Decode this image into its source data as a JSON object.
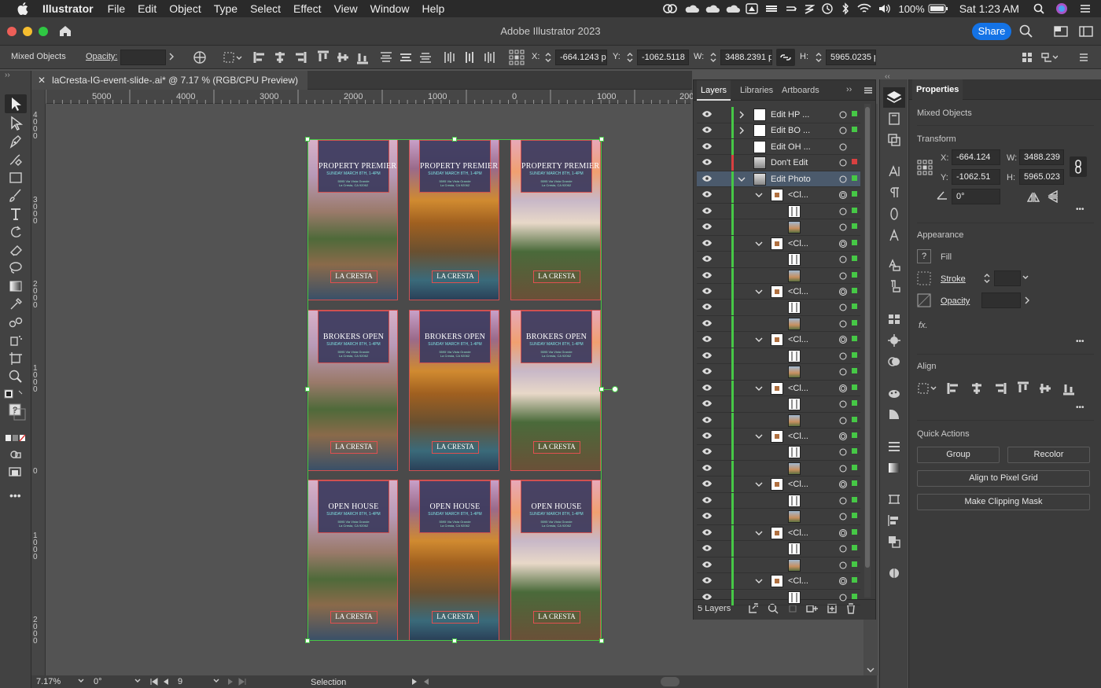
{
  "menubar": {
    "app": "Illustrator",
    "items": [
      "File",
      "Edit",
      "Object",
      "Type",
      "Select",
      "Effect",
      "View",
      "Window",
      "Help"
    ],
    "battery": "100%",
    "clock": "Sat 1:23 AM"
  },
  "window": {
    "title": "Adobe Illustrator 2023",
    "share_label": "Share"
  },
  "options_bar": {
    "selection_label": "Mixed Objects",
    "opacity_label": "Opacity:",
    "x_label": "X:",
    "x_value": "-664.1243 p",
    "y_label": "Y:",
    "y_value": "-1062.5118",
    "w_label": "W:",
    "w_value": "3488.2391 p",
    "h_label": "H:",
    "h_value": "5965.0235 p"
  },
  "document_tab": {
    "title": "laCresta-IG-event-slide-.ai* @ 7.17 % (RGB/CPU Preview)"
  },
  "ruler": {
    "h_ticks": [
      "5000",
      "4000",
      "3000",
      "2000",
      "1000",
      "0",
      "1000",
      "200"
    ],
    "v_ticks": [
      "4\n0\n0\n0",
      "3\n0\n0\n0",
      "2\n0\n0\n0",
      "1\n0\n0\n0",
      "0",
      "1\n0\n0\n0",
      "2\n0\n0\n0"
    ]
  },
  "artboard": {
    "rows": [
      {
        "title": "PROPERTY PREMIERE"
      },
      {
        "title": "BROKERS OPEN"
      },
      {
        "title": "OPEN HOUSE"
      }
    ],
    "subtitle": "SUNDAY MARCH 8TH, 1-4PM",
    "address_1": "5595 Via Vista Grande",
    "address_2": "La Cresta, CA 92062",
    "logo_text": "LA CRESTA"
  },
  "status_bar": {
    "zoom": "7.17%",
    "rotation": "0°",
    "artboard": "9",
    "tool": "Selection"
  },
  "layers_panel": {
    "tabs": [
      "Layers",
      "Libraries",
      "Artboards"
    ],
    "footer_count": "5 Layers",
    "top_layers": [
      {
        "name": "Edit HP ...",
        "color": "#46c846"
      },
      {
        "name": "Edit BO ...",
        "color": "#46c846"
      },
      {
        "name": "Edit OH ...",
        "color": "#46c846"
      },
      {
        "name": "Don't Edit",
        "color": "#d84040"
      },
      {
        "name": "Edit Photo",
        "color": "#46c846"
      }
    ],
    "clip_group_label": "<Cl..."
  },
  "properties": {
    "tab": "Properties",
    "selection_label": "Mixed Objects",
    "transform_title": "Transform",
    "x_label": "X:",
    "x_value": "-664.124",
    "y_label": "Y:",
    "y_value": "-1062.51",
    "w_label": "W:",
    "w_value": "3488.239",
    "h_label": "H:",
    "h_value": "5965.023",
    "angle_value": "0°",
    "appearance_title": "Appearance",
    "fill_label": "Fill",
    "stroke_label": "Stroke",
    "opacity_label": "Opacity",
    "fx_label": "fx.",
    "align_title": "Align",
    "quick_actions_title": "Quick Actions",
    "group_label": "Group",
    "recolor_label": "Recolor",
    "pixel_grid_label": "Align to Pixel Grid",
    "clip_mask_label": "Make Clipping Mask"
  },
  "colors": {
    "accent": "#1473e6",
    "selection": "#46c846",
    "red_layer": "#d84040"
  }
}
